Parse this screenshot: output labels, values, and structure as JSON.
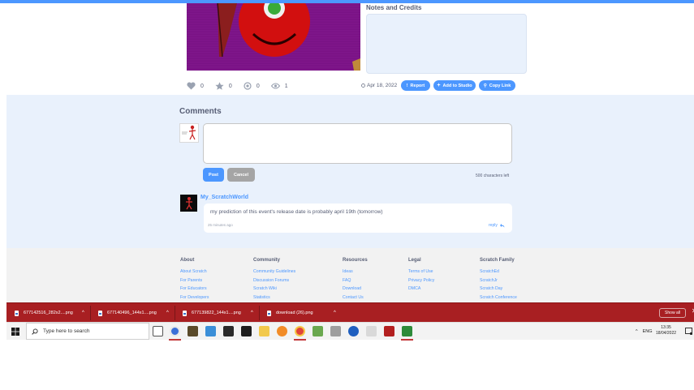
{
  "project": {
    "notes_title": "Notes and Credits",
    "stats": {
      "loves": "0",
      "favorites": "0",
      "remixes": "0",
      "views": "1"
    },
    "date": "Apr 18, 2022",
    "report_label": "Report",
    "add_to_studio_label": "Add to Studio",
    "copy_link_label": "Copy Link"
  },
  "comments": {
    "heading": "Comments",
    "input_value": "",
    "post_label": "Post",
    "cancel_label": "Cancel",
    "chars_left": "500 characters left",
    "items": [
      {
        "username": "My_ScratchWorld",
        "text": "my prediction of this event's release date is probably april 19th (tomorrow)",
        "time": "25 minutes ago",
        "reply_label": "reply"
      }
    ]
  },
  "footer": {
    "columns": [
      {
        "heading": "About",
        "links": [
          "About Scratch",
          "For Parents",
          "For Educators",
          "For Developers"
        ]
      },
      {
        "heading": "Community",
        "links": [
          "Community Guidelines",
          "Discussion Forums",
          "Scratch Wiki",
          "Statistics"
        ]
      },
      {
        "heading": "Resources",
        "links": [
          "Ideas",
          "FAQ",
          "Download",
          "Contact Us"
        ]
      },
      {
        "heading": "Legal",
        "links": [
          "Terms of Use",
          "Privacy Policy",
          "DMCA"
        ]
      },
      {
        "heading": "Scratch Family",
        "links": [
          "ScratchEd",
          "ScratchJr",
          "Scratch Day",
          "Scratch Conference"
        ]
      }
    ]
  },
  "downloads": {
    "items": [
      "677142516_282x2....png",
      "677140496_144x1....png",
      "677139822_144x1....png",
      "download (26).png"
    ],
    "show_all_label": "Show all",
    "close_glyph": "✕"
  },
  "taskbar": {
    "search_placeholder": "Type here to search",
    "language": "ENG",
    "time": "13:35",
    "date": "18/04/2022"
  },
  "colors": {
    "accent": "#4c97ff",
    "downloads_bar": "#a81f22",
    "comments_bg": "#e9f1fc"
  }
}
